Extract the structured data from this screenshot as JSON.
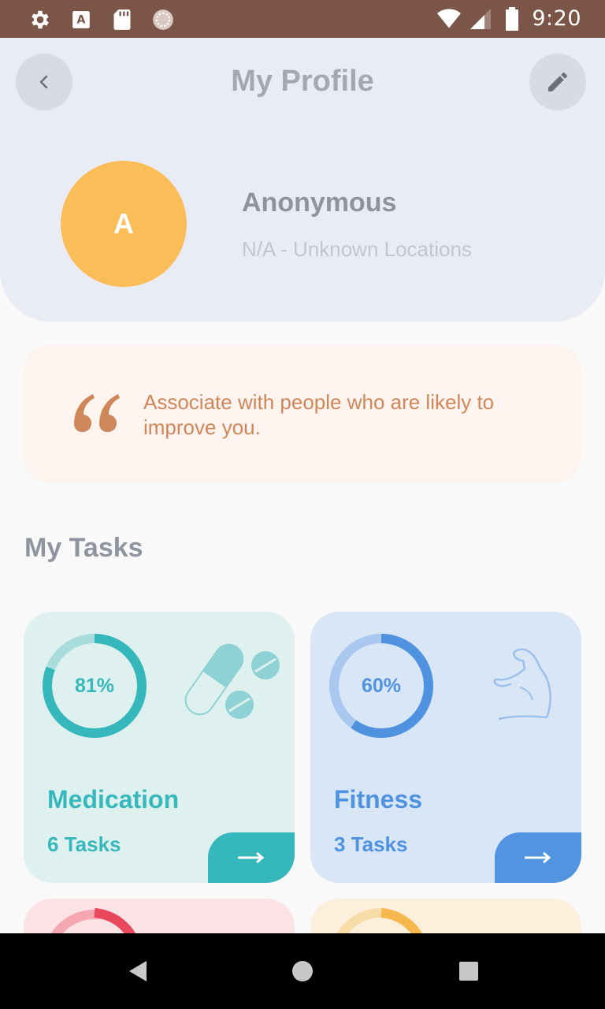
{
  "status_bar": {
    "time": "9:20",
    "left_icons": [
      "gear-icon",
      "font-a-icon",
      "sd-card-icon",
      "sync-icon"
    ],
    "right_icons": [
      "wifi-icon",
      "signal-icon",
      "battery-icon"
    ]
  },
  "header": {
    "title": "My Profile",
    "back_icon": "chevron-left-icon",
    "edit_icon": "pencil-icon"
  },
  "profile": {
    "avatar_initial": "A",
    "avatar_color": "#fbbd58",
    "name": "Anonymous",
    "location": "N/A - Unknown Locations"
  },
  "quote": {
    "text": "Associate with people who are likely to improve you.",
    "color": "#cf875a"
  },
  "tasks_section": {
    "title": "My Tasks",
    "cards": [
      {
        "title": "Medication",
        "count_label": "6 Tasks",
        "progress": 0.81,
        "progress_label": "81%",
        "accent": "#36b7bc",
        "track": "#a9dcdc",
        "icon": "pills-icon"
      },
      {
        "title": "Fitness",
        "count_label": "3 Tasks",
        "progress": 0.6,
        "progress_label": "60%",
        "accent": "#4f93e0",
        "track": "#a8c8ef",
        "icon": "muscle-arm-icon"
      }
    ]
  },
  "nav_bar": {
    "buttons": [
      "back-triangle-icon",
      "home-circle-icon",
      "recents-square-icon"
    ]
  }
}
